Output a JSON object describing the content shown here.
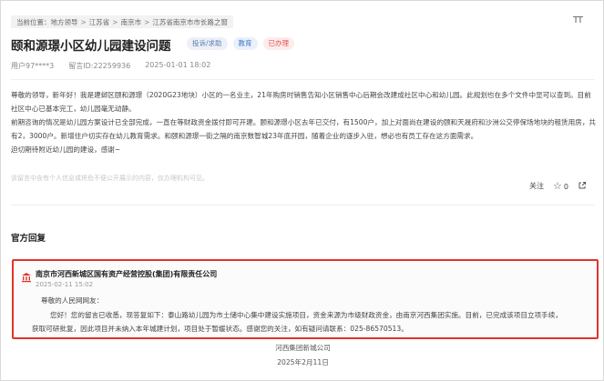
{
  "breadcrumb": {
    "items": [
      "当前位置：地方领导",
      "江苏省",
      "南京市",
      "江苏省南京市市长路之窗"
    ],
    "separator": ">"
  },
  "font_toggle": "TT",
  "post": {
    "title": "颐和源璟小区幼儿园建设问题",
    "tags": [
      "投诉/求助",
      "教育",
      "已办理"
    ],
    "user": "用户97****3",
    "message_id": "留言ID:22259936",
    "date": "2025-01-01 18:02",
    "paragraphs": [
      "尊敬的领导，新年好！我是建邺区颐和源璟（2020G23地块）小区的一名业主，21年购房时销售告知小区销售中心后期会改建成社区中心和幼儿园。此规划也在多个文件中显可以查到。目前社区中心已基本完工，幼儿园毫无动静。",
      "前期咨询的情况是幼儿园方案设计已全部完成，一直在等财政资金拨付即可开建。颐和源璟小区去年已交付，有1500户，加上对面尚在建设的颐和天晟府和沙洲公交停保场地块的租赁用房，共有2，3000户。新增住户切实存在幼儿教育需求。和颐和源璟一街之隔的南京数智城23年底开园，随着企业的逐步入驻，想必也有员工存在这方面需求。",
      "迫切期待附近幼儿园的建设，感谢~"
    ],
    "disclaimer": "该留言中含有个人信息或将危不便公开展示的内容，仅办理机构可见。",
    "follow_label": "关注",
    "like_count": "0"
  },
  "official_reply": {
    "section_title": "官方回复",
    "org_name": "南京市河西新城区国有资产经营控股(集团)有限责任公司",
    "date": "2025-02-11 15:02",
    "greeting": "尊敬的人民网网友：",
    "body_line1": "您好！您的留言已收悉，现答复如下：泰山路幼儿园为市土储中心集中建设实施项目，资金来源为市级财政资金，由南京河西集团实施。目前，已完成该项目立项手续，",
    "body_line2": "获取可研批复，因此项目并未纳入本年城建计划，项目处于暂缓状态。感谢您的关注，如有疑问请联系：025-86570513。",
    "signature_org": "河西集团新城公司",
    "signature_date": "2025年2月11日"
  },
  "colors": {
    "highlight_border": "#e0342c",
    "tag_status": "#e05252",
    "tag_domain": "#3b78c9"
  }
}
